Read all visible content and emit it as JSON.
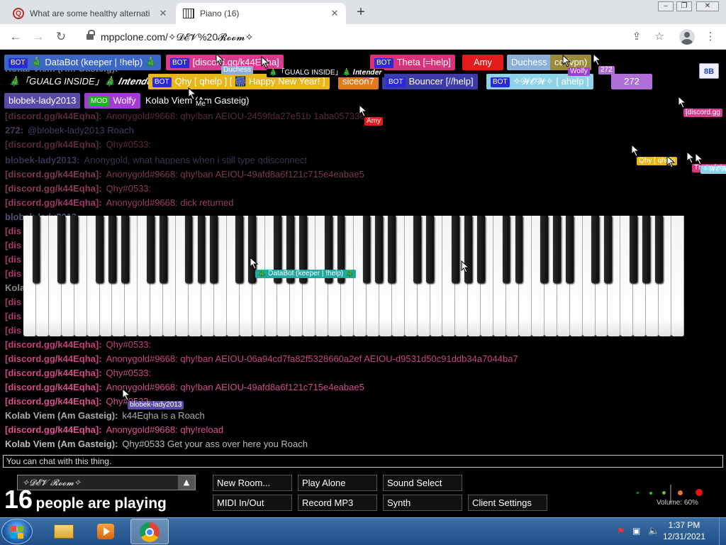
{
  "browser": {
    "tabs": [
      {
        "title": "What are some healthy alternati",
        "favicon": "quora-icon",
        "active": false
      },
      {
        "title": "Piano (16)",
        "favicon": "piano-icon",
        "active": true
      }
    ],
    "url": "mppclone.com/✧𝓓𝓔𝓥%20𝓡𝓸𝓸𝓶✧"
  },
  "participants": {
    "row1": [
      {
        "badge": "BOT",
        "name": "🎄 DataBot (keeper | !help) 🎄",
        "color": "#3a66c4"
      },
      {
        "badge": "BOT",
        "name": "[discord.gg/k44Eqha]",
        "color": "#d83a8e"
      },
      {
        "badge": "BOT",
        "name": "Theta [=help]",
        "color": "#d8327a"
      },
      {
        "badge": "",
        "name": "Amy",
        "color": "#e51b1b"
      },
      {
        "badge": "",
        "name": "Duchess",
        "color": "#8ab0d8"
      },
      {
        "badge": "",
        "name": "cc (vpn)",
        "color": "#9a8a3a"
      }
    ],
    "row2": [
      {
        "badge": "",
        "name": "🎄「GUALG INSIDE」🎄 𝑰𝒏𝒕𝒆𝒏𝒅𝒆𝒓",
        "color": "#000000"
      },
      {
        "badge": "BOT",
        "name": "Qhy [ qhelp ] [ 🎆 Happy New Year! ]",
        "color": "#e8b51a"
      },
      {
        "badge": "",
        "name": "siceon7",
        "color": "#e37a1a"
      },
      {
        "badge": "BOT",
        "name": "Bouncer [//help]",
        "color": "#3c3ca8"
      },
      {
        "badge": "BOT",
        "name": "✧𝓦𝓞𝓦✧ [ ahelp ]",
        "color": "#8fd3e8"
      },
      {
        "badge": "",
        "name": "272",
        "color": "#b06fd8"
      }
    ],
    "row3": [
      {
        "badge": "",
        "name": "blobek-lady2013",
        "color": "#5a4aa8"
      },
      {
        "badge": "MOD",
        "name": "Wolfy",
        "color": "#a43ad8"
      },
      {
        "badge": "",
        "name": "Kolab Viem (Am Gasteig)",
        "color": "#000000"
      }
    ]
  },
  "chat": [
    {
      "name": "Kolab Viem (Am Gasteig):",
      "text": "",
      "color": "#777777"
    },
    {
      "name": "[discord.gg/k44Eqha]:",
      "text": "Anonygold#9668: qhy!ban AEIOU-2459fda27e51b 1aba05733e",
      "color": "#5a2a3a"
    },
    {
      "name": "272:",
      "text": "@blobek-lady2013 Roach",
      "color": "#4a3a5a"
    },
    {
      "name": "[discord.gg/k44Eqha]:",
      "text": "Qhy#0533:",
      "color": "#5a2a3a"
    },
    {
      "name": "blobek-lady2013:",
      "text": "Anonygold, what happens when i still type qdisconnect",
      "color": "#3a3450"
    },
    {
      "name": "[discord.gg/k44Eqha]:",
      "text": "Anonygold#9668: qhy!ban AEIOU-49afd8a6f121c715e4eabae5",
      "color": "#7a3a52"
    },
    {
      "name": "[discord.gg/k44Eqha]:",
      "text": "Qhy#0533:",
      "color": "#8a3a5a"
    },
    {
      "name": "[discord.gg/k44Eqha]:",
      "text": "Anonygold#9668: dick returned",
      "color": "#9a3a62"
    },
    {
      "name": "blobek-lady2013:",
      "text": "",
      "color": "#5a5080"
    },
    {
      "name": "[dis",
      "text": "",
      "color": "#a83a6a"
    },
    {
      "name": "[dis",
      "text": "",
      "color": "#a83a6a"
    },
    {
      "name": "[dis",
      "text": "",
      "color": "#a83a6a"
    },
    {
      "name": "[dis",
      "text": "",
      "color": "#a83a6a"
    },
    {
      "name": "Kola",
      "text": "",
      "color": "#888888"
    },
    {
      "name": "[dis",
      "text": "",
      "color": "#a83a6a"
    },
    {
      "name": "[dis",
      "text": "",
      "color": "#a83a6a"
    },
    {
      "name": "[dis",
      "text": "",
      "color": "#a83a6a"
    },
    {
      "name": "[discord.gg/k44Eqha]:",
      "text": "Qhy#0533:",
      "color": "#c2407a"
    },
    {
      "name": "[discord.gg/k44Eqha]:",
      "text": "Anonygold#9668: qhy!ban AEIOU-06a94cd7fa82f5328660a2ef AEIOU-d9531d50c91ddb34a7044ba7",
      "color": "#c8447e"
    },
    {
      "name": "[discord.gg/k44Eqha]:",
      "text": "Qhy#0533:",
      "color": "#cc4882"
    },
    {
      "name": "[discord.gg/k44Eqha]:",
      "text": "Anonygold#9668: qhy!ban AEIOU-49afd8a6f121c715e4eabae5",
      "color": "#d04c86"
    },
    {
      "name": "[discord.gg/k44Eqha]:",
      "text": "Qhy#0533:",
      "color": "#d4508a"
    },
    {
      "name": "Kolab Viem (Am Gasteig):",
      "text": "k44Eqha is a Roach",
      "color": "#aaaaaa"
    },
    {
      "name": "[discord.gg/k44Eqha]:",
      "text": "Anonygold#9668: qhy!reload",
      "color": "#dc548e"
    },
    {
      "name": "Kolab Viem (Am Gasteig):",
      "text": "Qhy#0533 Get your ass over here you Roach",
      "color": "#bbbbbb"
    }
  ],
  "cursors": [
    {
      "label": "Duchess",
      "color": "#8ab0d8"
    },
    {
      "label": "🎄「GUALG INSIDE」🎄 𝑰𝒏𝒕𝒆𝒏𝒅𝒆𝒓",
      "color": "#000000"
    },
    {
      "label": "Wolfy",
      "color": "#a43ad8"
    },
    {
      "label": "272",
      "color": "#b06fd8"
    },
    {
      "label": "Me",
      "color": "#000000"
    },
    {
      "label": "Amy",
      "color": "#e51b1b"
    },
    {
      "label": "[discord.gg",
      "color": "#d83a8e"
    },
    {
      "label": "Qhy [ qhelp",
      "color": "#e8b51a"
    },
    {
      "label": "Theta [=help",
      "color": "#d8327a"
    },
    {
      "label": "✧𝓦𝓞𝓦",
      "color": "#8fd3e8"
    },
    {
      "label": "🎄 DataBot (keeper | !help) 🎄",
      "color": "#22a6a0"
    },
    {
      "label": "blobek-lady2013",
      "color": "#5a4aa8"
    }
  ],
  "top_right_button": "8B",
  "chat_input": {
    "placeholder": "You can chat with this thing."
  },
  "room": {
    "name": "✧𝓓𝓔𝓥 𝓡𝓸𝓸𝓶✧",
    "player_count": "16",
    "player_text": "people are playing"
  },
  "controls": {
    "new_room": "New Room...",
    "play_alone": "Play Alone",
    "sound_select": "Sound Select",
    "midi": "MIDI In/Out",
    "record": "Record MP3",
    "synth": "Synth",
    "client_settings": "Client Settings"
  },
  "volume": {
    "label": "Volume: 60%",
    "level": 0.6
  },
  "taskbar": {
    "time": "1:37 PM",
    "date": "12/31/2021"
  }
}
